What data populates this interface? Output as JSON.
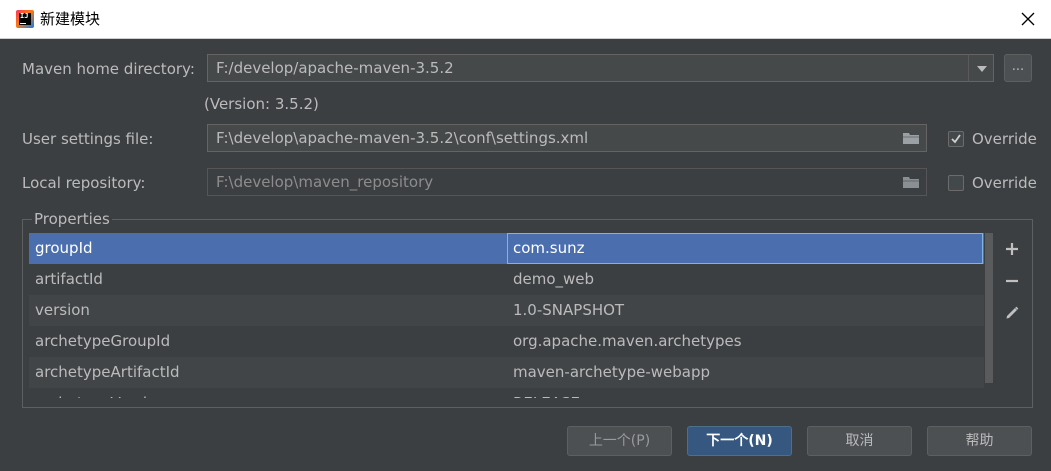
{
  "window": {
    "title": "新建模块"
  },
  "maven": {
    "home_label": "Maven home directory:",
    "home_value": "F:/develop/apache-maven-3.5.2",
    "browse_label": "...",
    "version_text": "(Version: 3.5.2)",
    "settings_label": "User settings file:",
    "settings_value": "F:\\develop\\apache-maven-3.5.2\\conf\\settings.xml",
    "settings_override_label": "Override",
    "settings_override_checked": true,
    "repo_label": "Local repository:",
    "repo_value": "F:\\develop\\maven_repository",
    "repo_override_label": "Override",
    "repo_override_checked": false
  },
  "properties": {
    "title": "Properties",
    "rows": [
      {
        "key": "groupId",
        "value": "com.sunz"
      },
      {
        "key": "artifactId",
        "value": "demo_web"
      },
      {
        "key": "version",
        "value": "1.0-SNAPSHOT"
      },
      {
        "key": "archetypeGroupId",
        "value": "org.apache.maven.archetypes"
      },
      {
        "key": "archetypeArtifactId",
        "value": "maven-archetype-webapp"
      },
      {
        "key": "archetypeVersion",
        "value": "RELEASE"
      }
    ],
    "selected_row": 0
  },
  "buttons": {
    "previous": "上一个(P)",
    "next": "下一个(N)",
    "cancel": "取消",
    "help": "帮助"
  },
  "colors": {
    "dialog_bg": "#3c3f41",
    "selection": "#4b6eaf",
    "primary_button": "#365880",
    "text": "#bbbbbb"
  },
  "icons": {
    "add": "plus-icon",
    "remove": "minus-icon",
    "edit": "pencil-icon",
    "folder": "folder-icon",
    "close": "close-icon"
  }
}
